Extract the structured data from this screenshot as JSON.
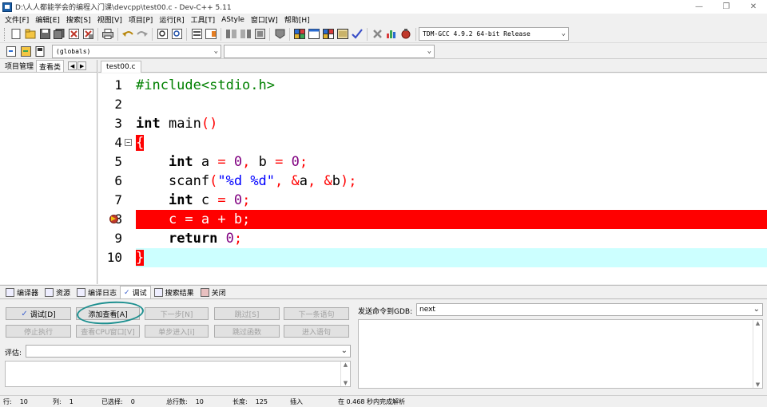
{
  "window": {
    "title": "D:\\人人都能学会的编程入门课\\devcpp\\test00.c - Dev-C++ 5.11"
  },
  "menu": [
    "文件[F]",
    "编辑[E]",
    "搜索[S]",
    "视图[V]",
    "项目[P]",
    "运行[R]",
    "工具[T]",
    "AStyle",
    "窗口[W]",
    "帮助[H]"
  ],
  "toolbar": {
    "compiler_select": "TDM-GCC 4.9.2 64-bit Release",
    "globals_select": "(globals)",
    "icons": [
      "new-file-icon",
      "open-icon",
      "save-icon",
      "save-all-icon",
      "close-icon",
      "close-all-icon",
      "print-icon",
      "undo-icon",
      "redo-icon",
      "find-icon",
      "replace-icon",
      "find-next-icon",
      "goto-line-icon",
      "indent-icon",
      "unindent-icon",
      "toggle-comment-icon",
      "project-options-icon",
      "compile-icon",
      "run-icon",
      "compile-run-icon",
      "rebuild-icon",
      "syntax-check-icon",
      "stop-icon",
      "profile-icon",
      "debug-icon"
    ]
  },
  "left_panel": {
    "tabs": [
      "项目管理",
      "查看类"
    ]
  },
  "editor": {
    "tab": "test00.c",
    "lines": [
      {
        "n": "1",
        "text": "#include<stdio.h>"
      },
      {
        "n": "2",
        "text": ""
      },
      {
        "n": "3",
        "text": "int main()"
      },
      {
        "n": "4",
        "text": "{"
      },
      {
        "n": "5",
        "text": "    int a = 0, b = 0;"
      },
      {
        "n": "6",
        "text": "    scanf(\"%d %d\", &a, &b);"
      },
      {
        "n": "7",
        "text": "    int c = 0;"
      },
      {
        "n": "8",
        "text": "    c = a + b;"
      },
      {
        "n": "9",
        "text": "    return 0;"
      },
      {
        "n": "10",
        "text": "}"
      }
    ]
  },
  "bottom_tabs": [
    "编译器",
    "资源",
    "编译日志",
    "调试",
    "搜索结果",
    "关闭"
  ],
  "debug": {
    "buttons_row1": [
      "调试[D]",
      "添加查看[A]",
      "下一步[N]",
      "跳过[S]",
      "下一条语句"
    ],
    "buttons_row2": [
      "停止执行",
      "查看CPU窗口[V]",
      "单步进入[i]",
      "跳过函数",
      "进入语句"
    ],
    "eval_label": "评估:",
    "gdb_label": "发送命令到GDB:",
    "gdb_value": "next"
  },
  "status": {
    "row_label": "行:",
    "row_value": "10",
    "col_label": "列:",
    "col_value": "1",
    "selected_label": "已选择:",
    "selected_value": "0",
    "total_label": "总行数:",
    "total_value": "10",
    "length_label": "长度:",
    "length_value": "125",
    "mode": "插入",
    "parse_message": "在 0.468 秒内完成解析"
  }
}
